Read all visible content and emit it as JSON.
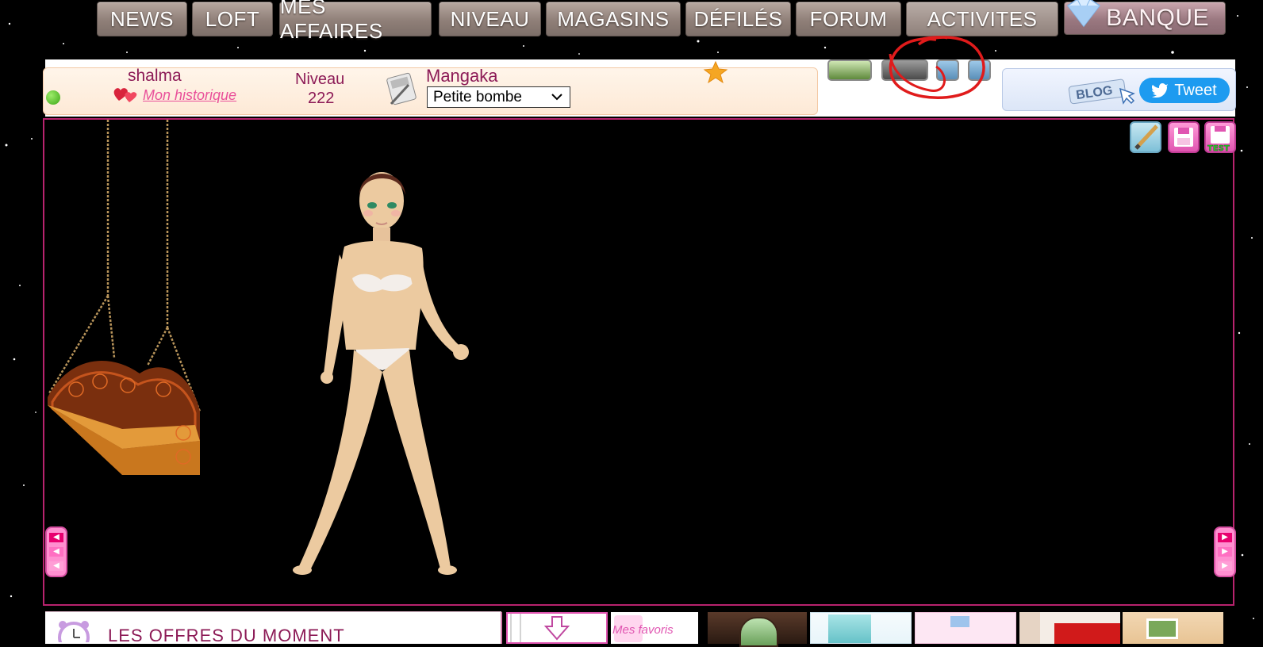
{
  "nav": {
    "items": [
      "NEWS",
      "LOFT",
      "MES AFFAIRES",
      "NIVEAU",
      "MAGASINS",
      "DÉFILÉS",
      "FORUM",
      "ACTIVITES"
    ],
    "bank_label": "BANQUE"
  },
  "profile": {
    "username": "shalma",
    "history_link": "Mon historique",
    "level_label": "Niveau",
    "level_value": "222",
    "job_title": "Mangaka",
    "style_selected": "Petite bombe",
    "online_color": "#4cc42a"
  },
  "share": {
    "blog_label": "BLOG",
    "tweet_label": "Tweet"
  },
  "tools": {
    "test_label": "TEST"
  },
  "bottom": {
    "offers_title": "LES OFFRES DU MOMENT",
    "favorites_label": "Mes favoris"
  },
  "colors": {
    "accent": "#b8236e",
    "nav_button": "#8f7f78",
    "tweet": "#1d9bf0",
    "annotation": "#e01b1b"
  }
}
